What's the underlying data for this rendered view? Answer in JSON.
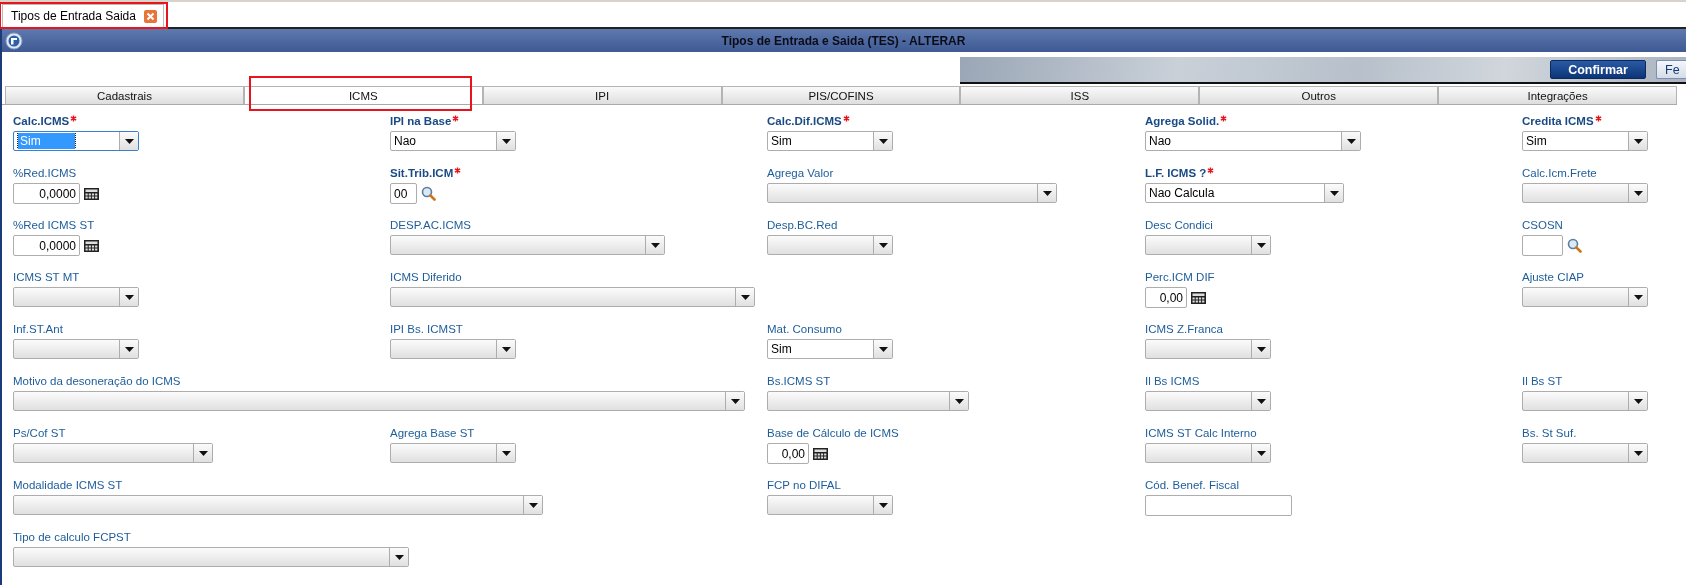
{
  "window_tabs": [
    {
      "label": "Tipos de Entrada Saida",
      "selected": true,
      "highlighted": true
    }
  ],
  "title": "Tipos de Entrada e Saida (TES) - ALTERAR",
  "actions": [
    {
      "label": "Confirmar",
      "kind": "primary"
    },
    {
      "label": "Fe",
      "kind": "secondary"
    }
  ],
  "tabs": [
    {
      "label": "Cadastrais",
      "selected": false,
      "highlighted": false
    },
    {
      "label": "ICMS",
      "selected": true,
      "highlighted": true
    },
    {
      "label": "IPI",
      "selected": false,
      "highlighted": false
    },
    {
      "label": "PIS/COFINS",
      "selected": false,
      "highlighted": false
    },
    {
      "label": "ISS",
      "selected": false,
      "highlighted": false
    },
    {
      "label": "Outros",
      "selected": false,
      "highlighted": false
    },
    {
      "label": "Integrações",
      "selected": false,
      "highlighted": false
    }
  ],
  "fields": [
    {
      "label": "Calc.ICMS",
      "required": true,
      "kind": "select",
      "value": "Sim",
      "focused": true
    },
    {
      "label": "IPI na Base",
      "required": true,
      "kind": "select",
      "value": "Nao",
      "focused": false
    },
    {
      "label": "Calc.Dif.ICMS",
      "required": true,
      "kind": "select",
      "value": "Sim",
      "focused": false
    },
    {
      "label": "Agrega Solid.",
      "required": true,
      "kind": "select",
      "value": "Nao",
      "focused": false
    },
    {
      "label": "Credita ICMS",
      "required": true,
      "kind": "select",
      "value": "Sim",
      "focused": false
    },
    {
      "label": "%Red.ICMS",
      "required": false,
      "kind": "number",
      "value": "0,0000",
      "focused": false
    },
    {
      "label": "Sit.Trib.ICM",
      "required": true,
      "kind": "lookup",
      "value": "00",
      "focused": false
    },
    {
      "label": "Agrega Valor",
      "required": false,
      "kind": "select",
      "focused": false
    },
    {
      "label": "L.F. ICMS ?",
      "required": true,
      "kind": "select",
      "value": "Nao Calcula",
      "focused": false
    },
    {
      "label": "Calc.Icm.Frete",
      "required": false,
      "kind": "select",
      "focused": false
    },
    {
      "label": "%Red ICMS ST",
      "required": false,
      "kind": "number",
      "value": "0,0000",
      "focused": false
    },
    {
      "label": "DESP.AC.ICMS",
      "required": false,
      "kind": "select",
      "focused": false
    },
    {
      "label": "Desp.BC.Red",
      "required": false,
      "kind": "select",
      "focused": false
    },
    {
      "label": "Desc Condici",
      "required": false,
      "kind": "select",
      "focused": false
    },
    {
      "label": "CSOSN",
      "required": false,
      "kind": "lookup",
      "focused": false
    },
    {
      "label": "ICMS ST MT",
      "required": false,
      "kind": "select",
      "focused": false
    },
    {
      "label": "ICMS Diferido",
      "required": false,
      "kind": "select",
      "focused": false
    },
    {
      "label": "Perc.ICM DIF",
      "required": false,
      "kind": "number",
      "value": "0,00",
      "focused": false
    },
    {
      "label": "Ajuste CIAP",
      "required": false,
      "kind": "select",
      "focused": false
    },
    {
      "label": "Inf.ST.Ant",
      "required": false,
      "kind": "select",
      "focused": false
    },
    {
      "label": "IPI Bs. ICMST",
      "required": false,
      "kind": "select",
      "focused": false
    },
    {
      "label": "Mat. Consumo",
      "required": false,
      "kind": "select",
      "value": "Sim",
      "focused": false
    },
    {
      "label": "ICMS Z.Franca",
      "required": false,
      "kind": "select",
      "focused": false
    },
    {
      "label": "Motivo da desoneração do ICMS",
      "required": false,
      "kind": "select",
      "focused": false
    },
    {
      "label": "Bs.ICMS ST",
      "required": false,
      "kind": "select",
      "focused": false
    },
    {
      "label": "Il Bs ICMS",
      "required": false,
      "kind": "select",
      "focused": false
    },
    {
      "label": "Il Bs ST",
      "required": false,
      "kind": "select",
      "focused": false
    },
    {
      "label": "Ps/Cof ST",
      "required": false,
      "kind": "select",
      "focused": false
    },
    {
      "label": "Agrega Base ST",
      "required": false,
      "kind": "select",
      "focused": false
    },
    {
      "label": "Base de Cálculo de ICMS",
      "required": false,
      "kind": "number",
      "value": "0,00",
      "focused": false
    },
    {
      "label": "ICMS ST Calc Interno",
      "required": false,
      "kind": "select",
      "focused": false
    },
    {
      "label": "Bs. St Suf.",
      "required": false,
      "kind": "select",
      "focused": false
    },
    {
      "label": "Modalidade ICMS ST",
      "required": false,
      "kind": "select",
      "focused": false
    },
    {
      "label": "FCP no DIFAL",
      "required": false,
      "kind": "select",
      "focused": false
    },
    {
      "label": "Cód. Benef. Fiscal",
      "required": false,
      "kind": "text",
      "focused": false
    },
    {
      "label": "Tipo de calculo FCPST",
      "required": false,
      "kind": "select",
      "focused": false
    }
  ]
}
